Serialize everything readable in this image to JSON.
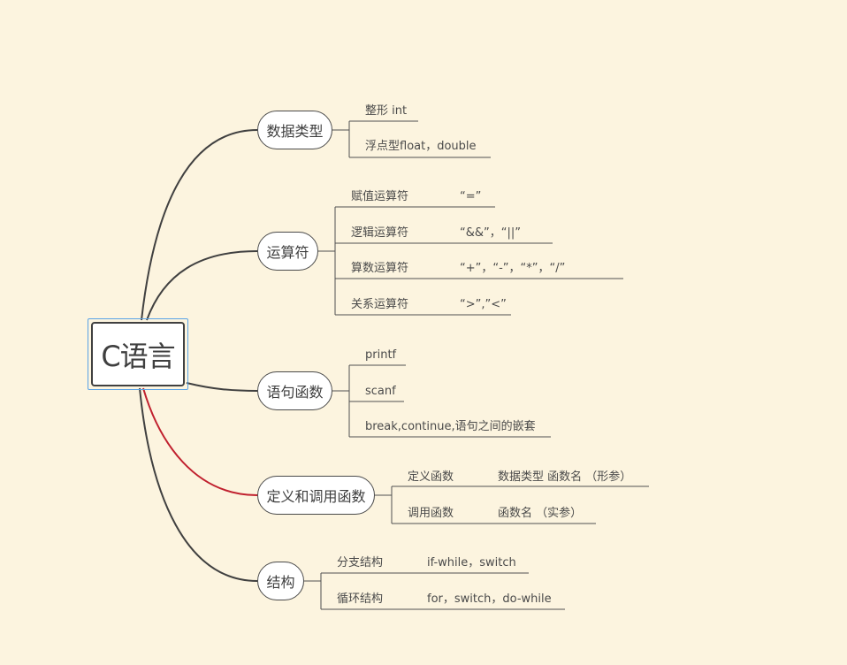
{
  "root": {
    "label": "C语言"
  },
  "branches": [
    {
      "label": "数据类型",
      "children": [
        {
          "label": "整形 int"
        },
        {
          "label": "浮点型float，double"
        }
      ]
    },
    {
      "label": "运算符",
      "children": [
        {
          "label": "赋值运算符",
          "value": "“=”"
        },
        {
          "label": "逻辑运算符",
          "value": "“&&”，“||”"
        },
        {
          "label": "算数运算符",
          "value": "“+”，“-”，“*”，“/”"
        },
        {
          "label": "关系运算符",
          "value": "“>”,”<”"
        }
      ]
    },
    {
      "label": "语句函数",
      "children": [
        {
          "label": "printf"
        },
        {
          "label": "scanf"
        },
        {
          "label": "break,continue,语句之间的嵌套"
        }
      ]
    },
    {
      "label": "定义和调用函数",
      "children": [
        {
          "label": "定义函数",
          "value": "数据类型 函数名 （形参）"
        },
        {
          "label": "调用函数",
          "value": "函数名 （实参）"
        }
      ]
    },
    {
      "label": "结构",
      "children": [
        {
          "label": "分支结构",
          "value": "if-while，switch"
        },
        {
          "label": "循环结构",
          "value": "for，switch，do-while"
        }
      ]
    }
  ],
  "colors": {
    "background": "#fcf4df",
    "line": "#404040",
    "highlight_line": "#c0202e",
    "selection": "#5aa3e6"
  }
}
